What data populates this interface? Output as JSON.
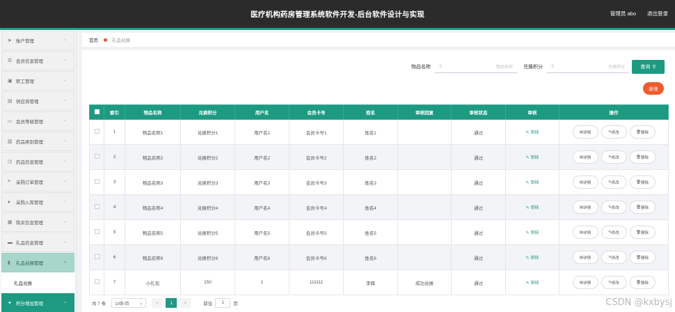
{
  "header": {
    "title": "医疗机构药房管理系统软件开发-后台软件设计与实现",
    "user": "管理员 abo",
    "logout": "退出登录"
  },
  "colors": {
    "primary": "#1e9a82",
    "accent": "#ee5b2d",
    "topbar": "#2b2b2b"
  },
  "sidebar": {
    "items": [
      {
        "label": "账户管理",
        "icon": "send-icon",
        "glyph": "➤"
      },
      {
        "label": "会员信息管理",
        "icon": "list-icon",
        "glyph": "☰"
      },
      {
        "label": "职工管理",
        "icon": "briefcase-icon",
        "glyph": "▣"
      },
      {
        "label": "供应商管理",
        "icon": "box-icon",
        "glyph": "▤"
      },
      {
        "label": "会员等级管理",
        "icon": "message-icon",
        "glyph": "▭"
      },
      {
        "label": "药品类别管理",
        "icon": "folder-icon",
        "glyph": "▥"
      },
      {
        "label": "药品信息管理",
        "icon": "clock-icon",
        "glyph": "◷"
      },
      {
        "label": "采购订单管理",
        "icon": "scan-icon",
        "glyph": "⌗"
      },
      {
        "label": "采购入库管理",
        "icon": "mic-icon",
        "glyph": "♦"
      },
      {
        "label": "购买信息管理",
        "icon": "document-icon",
        "glyph": "▦"
      },
      {
        "label": "礼品信息管理",
        "icon": "card-icon",
        "glyph": "▬"
      },
      {
        "label": "礼品兑换管理",
        "icon": "chart-icon",
        "glyph": "▮"
      }
    ],
    "sub_item": "礼品兑换",
    "bottom_item": {
      "label": "积分增加管理",
      "icon": "star-icon",
      "glyph": "✦"
    }
  },
  "breadcrumb": {
    "home": "首页",
    "current": "礼品兑换"
  },
  "search": {
    "field1_label": "物品名称",
    "field1_placeholder": "物品名称",
    "field2_label": "兑换积分",
    "field2_placeholder": "兑换积分",
    "query_button": "查询",
    "add_button": "新增"
  },
  "table": {
    "headers": [
      "索引",
      "物品名称",
      "兑换积分",
      "用户名",
      "会员卡号",
      "姓名",
      "审核回复",
      "审核状态",
      "审核",
      "操作"
    ],
    "audit_label": "审核",
    "actions": [
      "详情",
      "修改",
      "删除"
    ],
    "rows": [
      {
        "index": "1",
        "name": "物品名称1",
        "points": "兑换积分1",
        "username": "用户名1",
        "card": "会员卡号1",
        "realname": "姓名1",
        "reply": "",
        "status": "通过"
      },
      {
        "index": "2",
        "name": "物品名称2",
        "points": "兑换积分2",
        "username": "用户名2",
        "card": "会员卡号2",
        "realname": "姓名2",
        "reply": "",
        "status": "通过"
      },
      {
        "index": "3",
        "name": "物品名称3",
        "points": "兑换积分3",
        "username": "用户名3",
        "card": "会员卡号3",
        "realname": "姓名3",
        "reply": "",
        "status": "通过"
      },
      {
        "index": "4",
        "name": "物品名称4",
        "points": "兑换积分4",
        "username": "用户名4",
        "card": "会员卡号4",
        "realname": "姓名4",
        "reply": "",
        "status": "通过"
      },
      {
        "index": "5",
        "name": "物品名称5",
        "points": "兑换积分5",
        "username": "用户名5",
        "card": "会员卡号5",
        "realname": "姓名5",
        "reply": "",
        "status": "通过"
      },
      {
        "index": "6",
        "name": "物品名称6",
        "points": "兑换积分6",
        "username": "用户名6",
        "card": "会员卡号6",
        "realname": "姓名6",
        "reply": "",
        "status": "通过"
      },
      {
        "index": "7",
        "name": "小礼包",
        "points": "150",
        "username": "1",
        "card": "111111",
        "realname": "李辉",
        "reply": "成功兑换",
        "status": "通过"
      }
    ]
  },
  "pagination": {
    "total": "共 7 条",
    "page_size": "10条/页",
    "prev": "<",
    "current_page": "1",
    "next": ">",
    "goto_label": "前往",
    "goto_value": "1",
    "page_suffix": "页"
  },
  "watermark": "CSDN @kxbysj"
}
